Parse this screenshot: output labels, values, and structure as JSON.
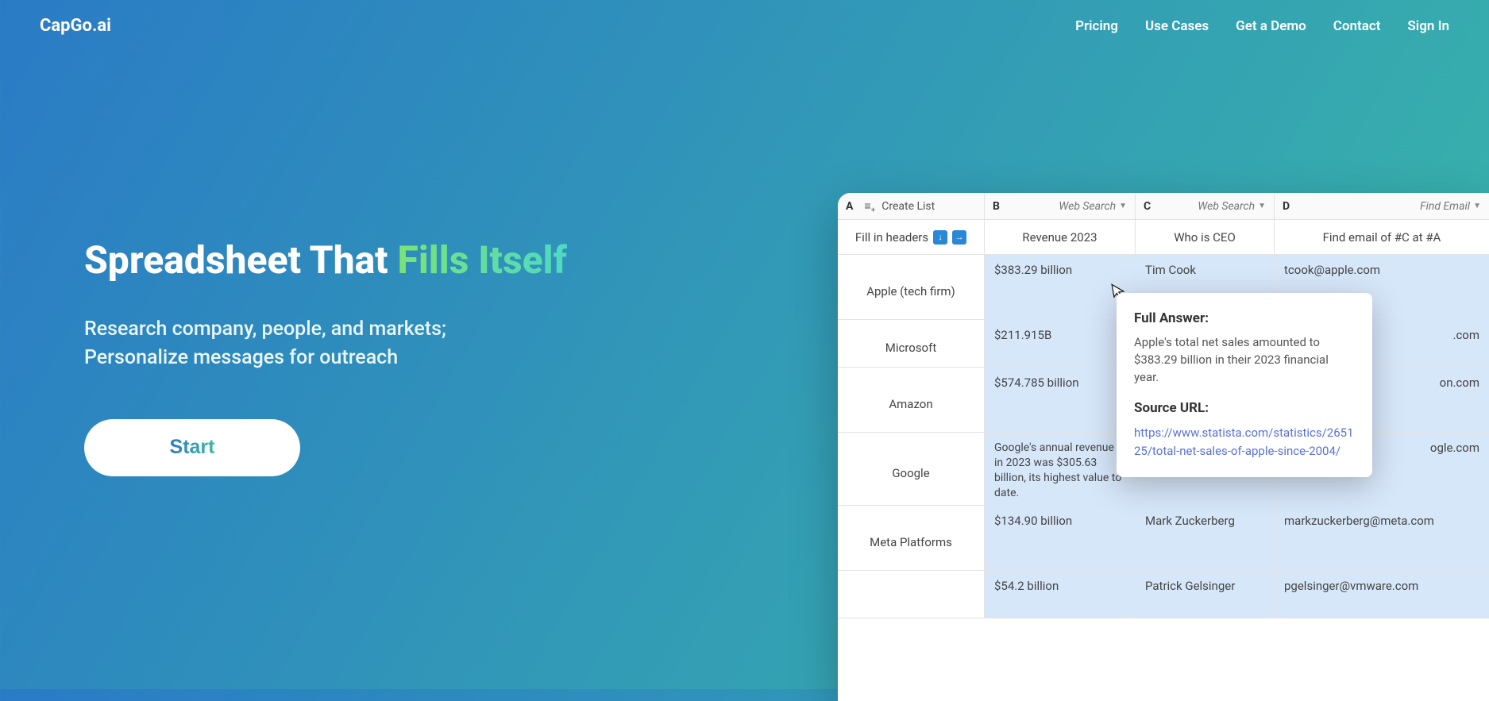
{
  "brand": "CapGo.ai",
  "nav": {
    "pricing": "Pricing",
    "use_cases": "Use Cases",
    "demo": "Get a Demo",
    "contact": "Contact",
    "signin": "Sign In"
  },
  "hero": {
    "title_lead": "Spreadsheet That ",
    "title_accent": "Fills Itself",
    "sub1": "Research company, people, and markets;",
    "sub2": "Personalize messages for outreach",
    "start": "Start"
  },
  "sheet": {
    "colA": {
      "letter": "A",
      "action": "Create List"
    },
    "colB": {
      "letter": "B",
      "action": "Web Search"
    },
    "colC": {
      "letter": "C",
      "action": "Web Search"
    },
    "colD": {
      "letter": "D",
      "action": "Find Email"
    },
    "headerA": "Fill in headers",
    "headerB": "Revenue 2023",
    "headerC": "Who is CEO",
    "headerD": "Find email of #C at #A",
    "rows": [
      {
        "a": "Apple (tech firm)",
        "b": "$383.29 billion",
        "c": "Tim Cook",
        "d": "tcook@apple.com"
      },
      {
        "a": "Microsoft",
        "b": "$211.915B",
        "c": "",
        "d": ".com"
      },
      {
        "a": "Amazon",
        "b": "$574.785 billion",
        "c": "",
        "d": "on.com"
      },
      {
        "a": "Google",
        "b": "Google's annual revenue in 2023 was $305.63 billion, its highest value to date.",
        "c": "",
        "d": "ogle.com"
      },
      {
        "a": "Meta Platforms",
        "b": "$134.90 billion",
        "c": "Mark Zuckerberg",
        "d": "markzuckerberg@meta.com"
      },
      {
        "a": "",
        "b": "$54.2 billion",
        "c": "Patrick Gelsinger",
        "d": "pgelsinger@vmware.com"
      }
    ]
  },
  "popup": {
    "h1": "Full Answer:",
    "p1": "Apple's total net sales amounted to $383.29 billion in their 2023 financial year.",
    "h2": "Source URL:",
    "url": "https://www.statista.com/statistics/265125/total-net-sales-of-apple-since-2004/"
  }
}
